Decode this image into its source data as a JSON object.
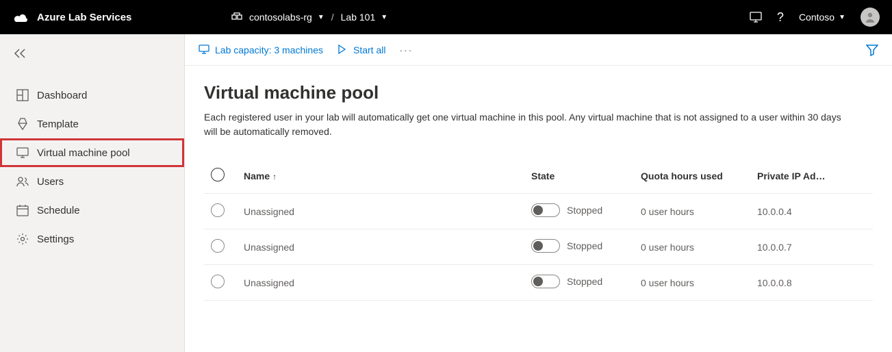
{
  "brand": "Azure Lab Services",
  "breadcrumb": {
    "rg": "contosolabs-rg",
    "lab": "Lab 101"
  },
  "tenant": "Contoso",
  "sidebar": {
    "items": [
      {
        "label": "Dashboard"
      },
      {
        "label": "Template"
      },
      {
        "label": "Virtual machine pool"
      },
      {
        "label": "Users"
      },
      {
        "label": "Schedule"
      },
      {
        "label": "Settings"
      }
    ]
  },
  "commands": {
    "capacity": "Lab capacity: 3 machines",
    "start_all": "Start all"
  },
  "page": {
    "title": "Virtual machine pool",
    "description": "Each registered user in your lab will automatically get one virtual machine in this pool. Any virtual machine that is not assigned to a user within 30 days will be automatically removed."
  },
  "table": {
    "columns": {
      "name": "Name",
      "state": "State",
      "quota": "Quota hours used",
      "ip": "Private IP Ad…"
    },
    "rows": [
      {
        "name": "Unassigned",
        "state": "Stopped",
        "quota": "0 user hours",
        "ip": "10.0.0.4"
      },
      {
        "name": "Unassigned",
        "state": "Stopped",
        "quota": "0 user hours",
        "ip": "10.0.0.7"
      },
      {
        "name": "Unassigned",
        "state": "Stopped",
        "quota": "0 user hours",
        "ip": "10.0.0.8"
      }
    ]
  }
}
